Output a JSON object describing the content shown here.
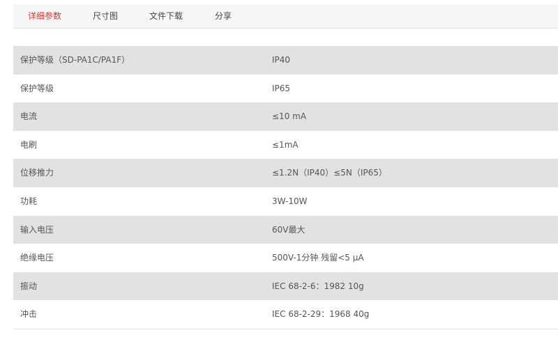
{
  "tabs": [
    {
      "label": "详细参数",
      "active": true
    },
    {
      "label": "尺寸图",
      "active": false
    },
    {
      "label": "文件下载",
      "active": false
    },
    {
      "label": "分享",
      "active": false
    }
  ],
  "colors": {
    "active_tab": "#e0322a",
    "row_shade": "#e2e2e2",
    "tab_bar_bg": "#f7f7f7"
  },
  "specs": [
    {
      "label": "保护等级（SD-PA1C/PA1F）",
      "value": "IP40"
    },
    {
      "label": "保护等级",
      "value": "IP65"
    },
    {
      "label": "电流",
      "value": "≤10 mA"
    },
    {
      "label": "电刷",
      "value": "≤1mA"
    },
    {
      "label": "位移推力",
      "value": "≤1.2N（IP40）≤5N（IP65）"
    },
    {
      "label": "功耗",
      "value": "3W-10W"
    },
    {
      "label": "输入电压",
      "value": "60V最大"
    },
    {
      "label": "绝缘电压",
      "value": "500V-1分钟 残留<5 μA"
    },
    {
      "label": "振动",
      "value": "IEC 68-2-6：1982 10g"
    },
    {
      "label": "冲击",
      "value": "IEC 68-2-29：1968 40g"
    }
  ]
}
